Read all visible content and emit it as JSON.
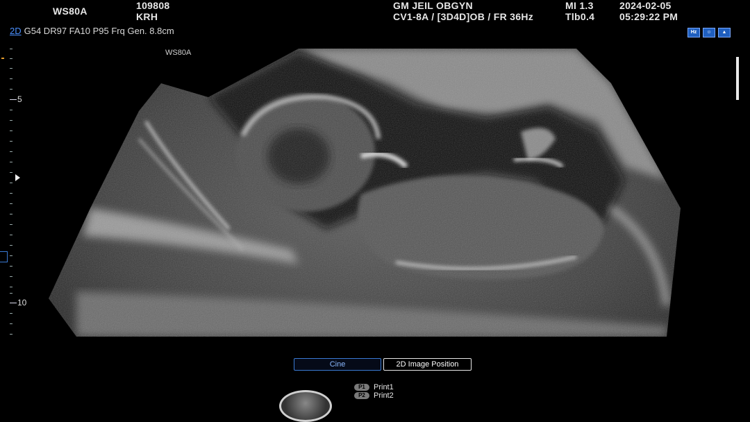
{
  "header": {
    "system": "WS80A",
    "patient_id": "109808",
    "operator": "KRH",
    "institution": "GM JEIL OBGYN",
    "probe_preset": "CV1-8A / [3D4D]OB / FR 36Hz",
    "mi": "MI  1.3",
    "tib": "Tlb0.4",
    "date": "2024-02-05",
    "time": "05:29:22 PM"
  },
  "params": {
    "mode": "2D",
    "settings": "G54 DR97 FA10 P95 Frq Gen. 8.8cm"
  },
  "image_label": "WS80A",
  "depth": {
    "label_5": "5",
    "label_10": "10"
  },
  "icons": [
    "hz-icon",
    "fetus-icon",
    "mountain-icon"
  ],
  "icon_text": {
    "hz": "Hz"
  },
  "buttons": {
    "cine": "Cine",
    "image_position": "2D Image Position"
  },
  "prints": {
    "p1_badge": "P1",
    "p1_label": "Print1",
    "p2_badge": "P2",
    "p2_label": "Print2"
  },
  "colors": {
    "accent_blue": "#3a7bd5",
    "mode_blue": "#4a90ff",
    "marker_orange": "#e39b2b"
  }
}
